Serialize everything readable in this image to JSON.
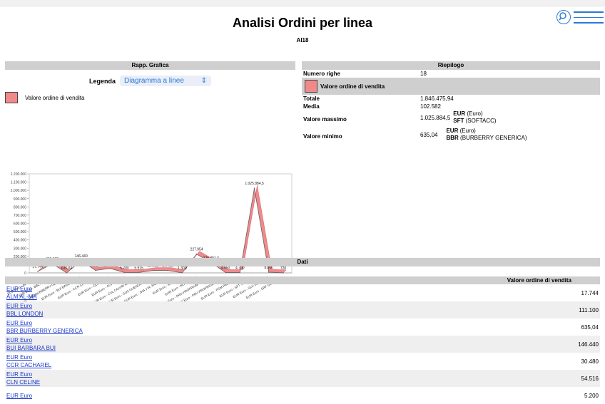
{
  "header": {
    "title": "Analisi Ordini per linea",
    "subtitle": "AI18"
  },
  "left_panel": {
    "title": "Rapp. Grafica",
    "legend_label": "Legenda",
    "legend_select": "Diagramma a linee",
    "series_label": "Valore ordine di vendita"
  },
  "summary": {
    "title": "Riepilogo",
    "numero_righe_label": "Numero righe",
    "numero_righe": "18",
    "series_label": "Valore ordine di vendita",
    "totale_label": "Totale",
    "totale": "1.846.475,94",
    "media_label": "Media",
    "media": "102.582",
    "massimo_label": "Valore massimo",
    "massimo": "1.025.884,5",
    "massimo_cur_code": "EUR",
    "massimo_cur_name": "(Euro)",
    "massimo_line_code": "SFT",
    "massimo_line_name": "(SOFTACC)",
    "minimo_label": "Valore minimo",
    "minimo": "635,04",
    "minimo_cur_code": "EUR",
    "minimo_cur_name": "(Euro)",
    "minimo_line_code": "BBR",
    "minimo_line_name": "(BURBERRY GENERICA)"
  },
  "dati": {
    "title": "Dati",
    "column": "Valore ordine di vendita",
    "rows": [
      {
        "currency": "EUR Euro",
        "line": "ALM AL-MA",
        "value": "17.744"
      },
      {
        "currency": "EUR Euro",
        "line": "BBL LONDON",
        "value": "111.100"
      },
      {
        "currency": "EUR Euro",
        "line": "BBR BURBERRY GENERICA",
        "value": "635,04"
      },
      {
        "currency": "EUR Euro",
        "line": "BUI BARBARA BUI",
        "value": "146.440"
      },
      {
        "currency": "EUR Euro",
        "line": "CCR CACHAREL",
        "value": "30.480"
      },
      {
        "currency": "EUR Euro",
        "line": "CLN CELINE",
        "value": "54.516"
      },
      {
        "currency": "EUR Euro",
        "line": "",
        "value": "5.200"
      }
    ]
  },
  "chart_data": {
    "type": "area",
    "series": [
      {
        "name": "Valore ordine di vendita",
        "color": "#f08a8a"
      }
    ],
    "categories": [
      "EUR Euro - ALM AL-MA",
      "EUR Euro - BBL LONDON",
      "EUR Euro - BBR BURBERRY GENERICA",
      "EUR Euro - BUI BARBARA BUI",
      "EUR Euro - CCR CACHAREL",
      "EUR Euro - CLN CELINE",
      "EUR Euro - COH COACH",
      "EUR Euro - CVL CALVIN KLEIN INC",
      "EUR Euro - GUS GUENDAY BIMBO",
      "EUR Euro - JHA J.W. ANDERSON",
      "EUR Euro - MAJ MAJE",
      "EUR Euro - MSG MSGM",
      "EUR Euro - PRD PROPRIUM - DONNA",
      "EUR Euro - PRU PROPRIUM - UOMO",
      "EUR Euro - PSM PAUL SMITH",
      "EUR Euro - SFT SOFTACC",
      "EUR Euro - SLU SLAM JAM",
      "EUR Euro - SRF SUBERELO"
    ],
    "values": [
      17744,
      111100,
      635.04,
      146440,
      30480,
      54516,
      5200,
      5915,
      29625,
      29421,
      1300,
      227954,
      126351.4,
      4950,
      4700,
      1025884.5,
      8900,
      720
    ],
    "labels": [
      "17.744",
      "111.100",
      "635,04",
      "146.440",
      "30.480",
      "54.516",
      "5.200",
      "5.915",
      "29.625",
      "29.421",
      "1.300",
      "227.954",
      "126.351,4",
      "4.950",
      "4.700",
      "1.025.884,5",
      "8.900",
      "720"
    ],
    "yticks": [
      "0",
      "100.000",
      "200.000",
      "300.000",
      "400.000",
      "500.000",
      "600.000",
      "700.000",
      "800.000",
      "900.000",
      "1.000.000",
      "1.100.000",
      "1.200.000"
    ],
    "ylim": [
      0,
      1200000
    ],
    "grid": false
  }
}
